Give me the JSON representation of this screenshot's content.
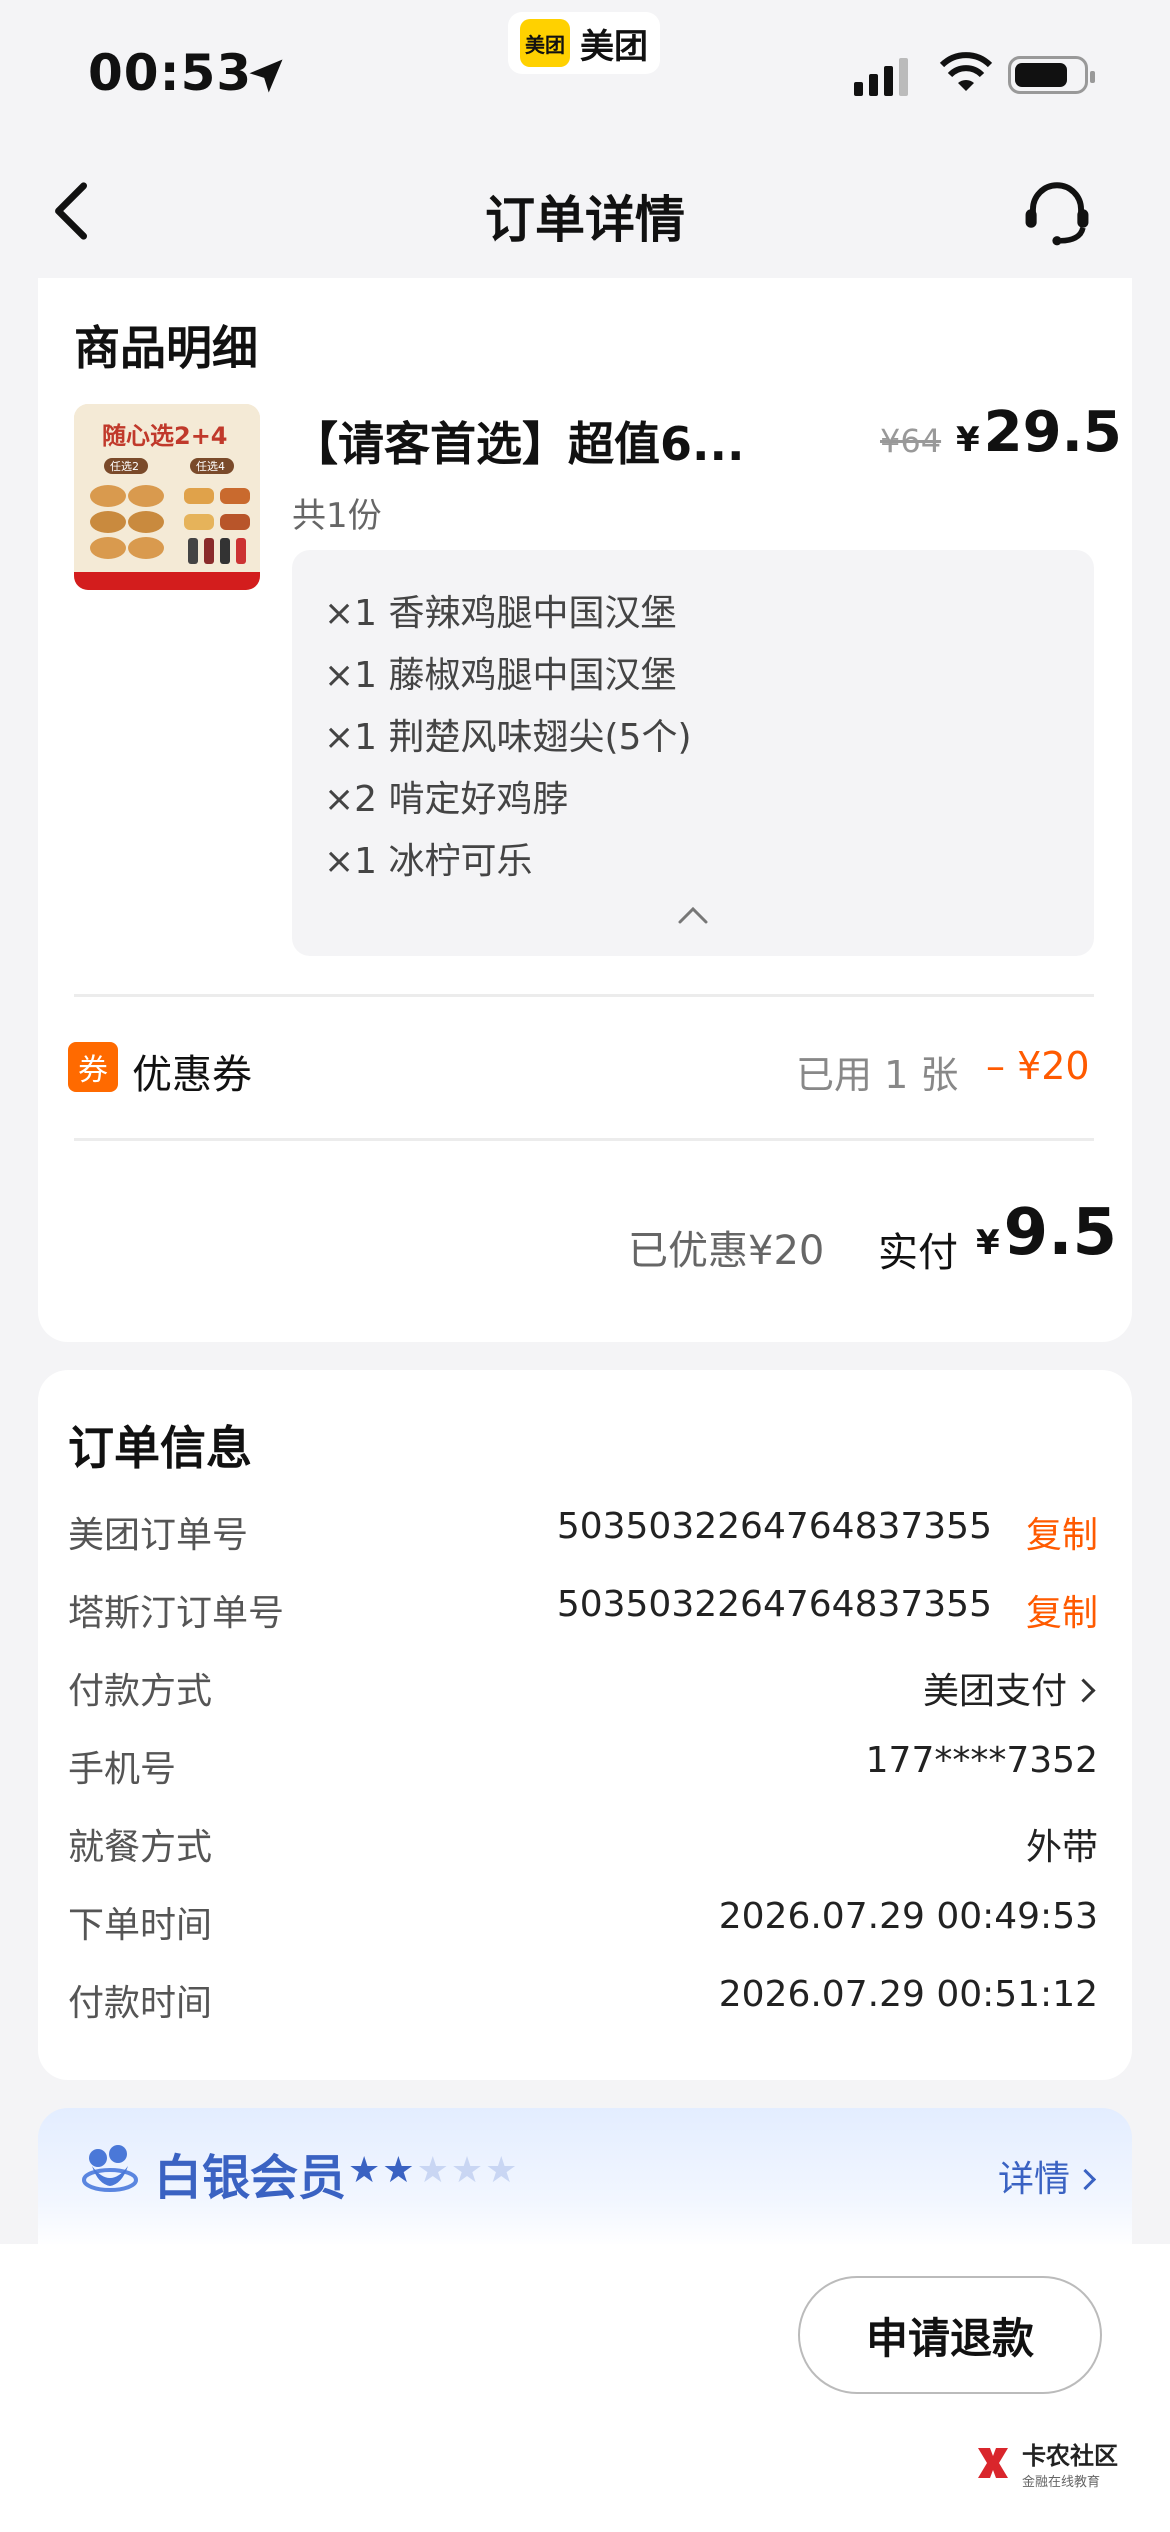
{
  "status_bar": {
    "time": "00:53",
    "app_badge": "美团",
    "app_name": "美团"
  },
  "nav": {
    "title": "订单详情"
  },
  "product_section": {
    "title": "商品明细",
    "product": {
      "image_text_main": "随心选2+4",
      "image_text_a": "任选2",
      "image_text_b": "任选4",
      "name": "【请客首选】超值6...",
      "original_price": "¥64",
      "currency": "¥",
      "price": "29.5",
      "quantity": "共1份"
    },
    "items": [
      "×1 香辣鸡腿中国汉堡",
      "×1 藤椒鸡腿中国汉堡",
      "×1 荆楚风味翅尖(5个)",
      "×2 啃定好鸡脖",
      "×1 冰柠可乐"
    ],
    "coupon": {
      "badge": "券",
      "label": "优惠券",
      "used": "已用 1 张",
      "amount": "– ¥20"
    },
    "summary": {
      "saved": "已优惠¥20",
      "paid_label": "实付",
      "currency": "¥",
      "paid_amount": "9.5"
    }
  },
  "order_info": {
    "title": "订单信息",
    "copy_label": "复制",
    "rows": [
      {
        "label": "美团订单号",
        "value": "5035032264764837355"
      },
      {
        "label": "塔斯汀订单号",
        "value": "5035032264764837355"
      },
      {
        "label": "付款方式",
        "value": "美团支付"
      },
      {
        "label": "手机号",
        "value": "177****7352"
      },
      {
        "label": "就餐方式",
        "value": "外带"
      },
      {
        "label": "下单时间",
        "value": "2026.07.29 00:49:53"
      },
      {
        "label": "付款时间",
        "value": "2026.07.29 00:51:12"
      }
    ]
  },
  "membership": {
    "title": "白银会员",
    "stars_filled": 2,
    "stars_total": 5,
    "detail": "详情"
  },
  "actions": {
    "refund": "申请退款"
  },
  "watermark": {
    "title": "卡农社区",
    "subtitle": "金融在线教育"
  },
  "colors": {
    "accent": "#ff5a00",
    "coupon_badge": "#ff6a00",
    "member_blue": "#3a62c2",
    "meituan_yellow": "#ffd100"
  }
}
